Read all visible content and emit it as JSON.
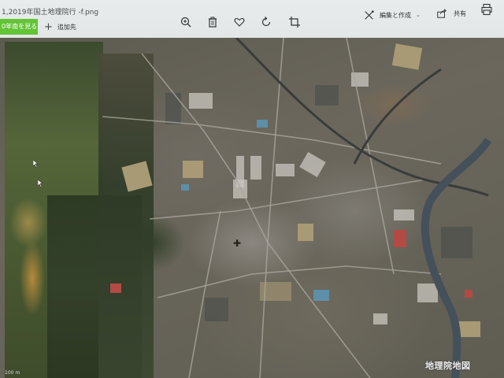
{
  "window": {
    "title": "1,2019年国土地理院行 -f.png"
  },
  "toolbar": {
    "see_all_label": "0年南を見る",
    "add_to_label": "追加先",
    "edit_create_label": "編集と作成",
    "share_label": "共有",
    "icons": [
      "zoom-in-icon",
      "delete-icon",
      "heart-icon",
      "rotate-icon",
      "crop-icon",
      "edit-create-icon",
      "share-icon",
      "print-icon"
    ]
  },
  "photo": {
    "watermark": "地理院地図",
    "scale_label": "100 m",
    "colors": {
      "forest": "#4a5a32",
      "urban": "#7d7a72",
      "river": "#44505a",
      "toolbar": "#e6e9e9",
      "accent_button": "#63c436"
    }
  }
}
